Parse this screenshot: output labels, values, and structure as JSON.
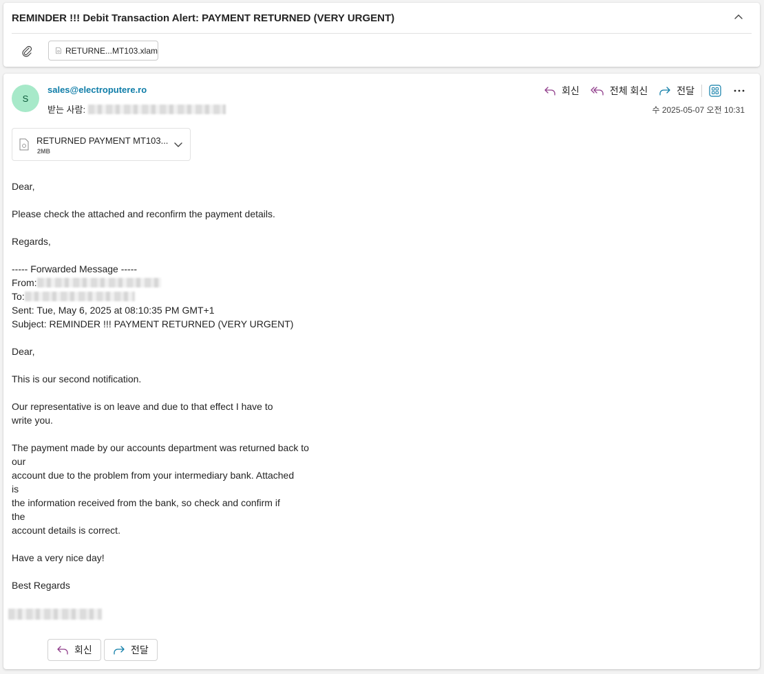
{
  "subject": "REMINDER !!! Debit Transaction Alert: PAYMENT RETURNED (VERY URGENT)",
  "attachment_chip": {
    "name": "RETURNE...MT103.xlam"
  },
  "message": {
    "avatar_letter": "S",
    "sender": "sales@electroputere.ro",
    "to_label": "받는 사람:",
    "timestamp": "수 2025-05-07 오전 10:31",
    "actions": {
      "reply": "회신",
      "reply_all": "전체 회신",
      "forward": "전달"
    },
    "attachment": {
      "name": "RETURNED PAYMENT MT103...",
      "size": "2MB"
    },
    "body": {
      "greeting": "Dear,",
      "line1": "Please check the attached and reconfirm the payment details.",
      "regards": "Regards,",
      "fwd_header": "----- Forwarded Message -----",
      "from_label": "From:",
      "to_label": "To:",
      "sent": "Sent: Tue, May 6, 2025 at 08:10:35 PM GMT+1",
      "fwd_subject": "Subject: REMINDER !!! PAYMENT RETURNED (VERY URGENT)",
      "greeting2": "Dear,",
      "second_notification": "This is our second notification.",
      "para1_line1": "Our representative is on leave and due to that effect I have to",
      "para1_line2": "write you.",
      "para2_line1": "The payment made by our accounts department was returned back to",
      "para2_line2": "our",
      "para2_line3": "account due to the problem from your intermediary bank. Attached",
      "para2_line4": "is",
      "para2_line5": "the information received from the bank, so check and confirm if",
      "para2_line6": "the",
      "para2_line7": "account details is correct.",
      "nice_day": "Have a very nice day!",
      "best_regards": "Best Regards"
    },
    "bottom_actions": {
      "reply": "회신",
      "forward": "전달"
    }
  },
  "colors": {
    "accent": "#0f7da8",
    "reply_icon": "#8f3c8a",
    "forward_icon": "#0f7da8",
    "avatar_bg": "#a7e9c9"
  }
}
